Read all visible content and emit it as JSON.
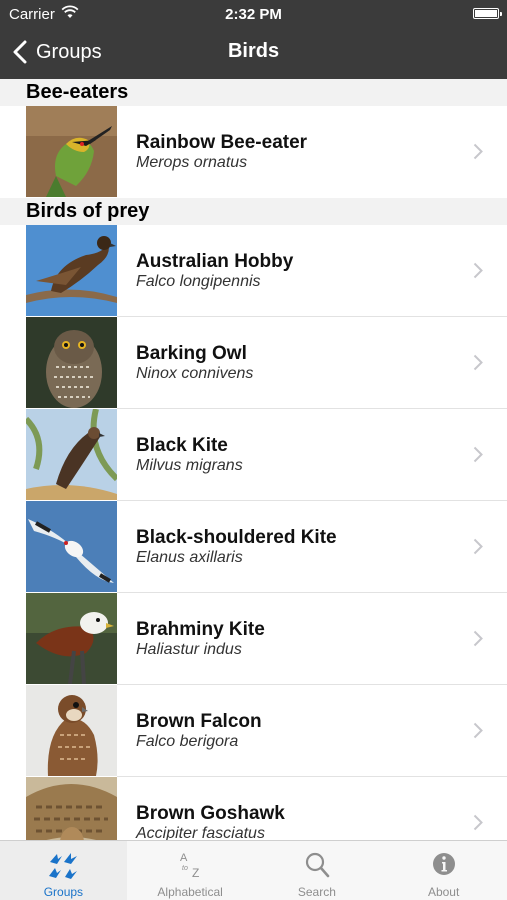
{
  "status_bar": {
    "carrier": "Carrier",
    "time": "2:32 PM"
  },
  "nav": {
    "back_label": "Groups",
    "title": "Birds"
  },
  "sections": [
    {
      "title": "Bee-eaters",
      "items": [
        {
          "name": "Rainbow Bee-eater",
          "scientific": "Merops ornatus"
        }
      ]
    },
    {
      "title": "Birds of prey",
      "items": [
        {
          "name": "Australian Hobby",
          "scientific": "Falco longipennis"
        },
        {
          "name": "Barking Owl",
          "scientific": "Ninox connivens"
        },
        {
          "name": "Black Kite",
          "scientific": "Milvus migrans"
        },
        {
          "name": "Black-shouldered Kite",
          "scientific": "Elanus axillaris"
        },
        {
          "name": "Brahminy Kite",
          "scientific": "Haliastur indus"
        },
        {
          "name": "Brown Falcon",
          "scientific": "Falco berigora"
        },
        {
          "name": "Brown Goshawk",
          "scientific": "Accipiter fasciatus"
        }
      ]
    }
  ],
  "tabbar": {
    "groups": "Groups",
    "alphabetical": "Alphabetical",
    "search": "Search",
    "about": "About",
    "active_color": "#1a73c9",
    "inactive_color": "#8e8e8e"
  }
}
